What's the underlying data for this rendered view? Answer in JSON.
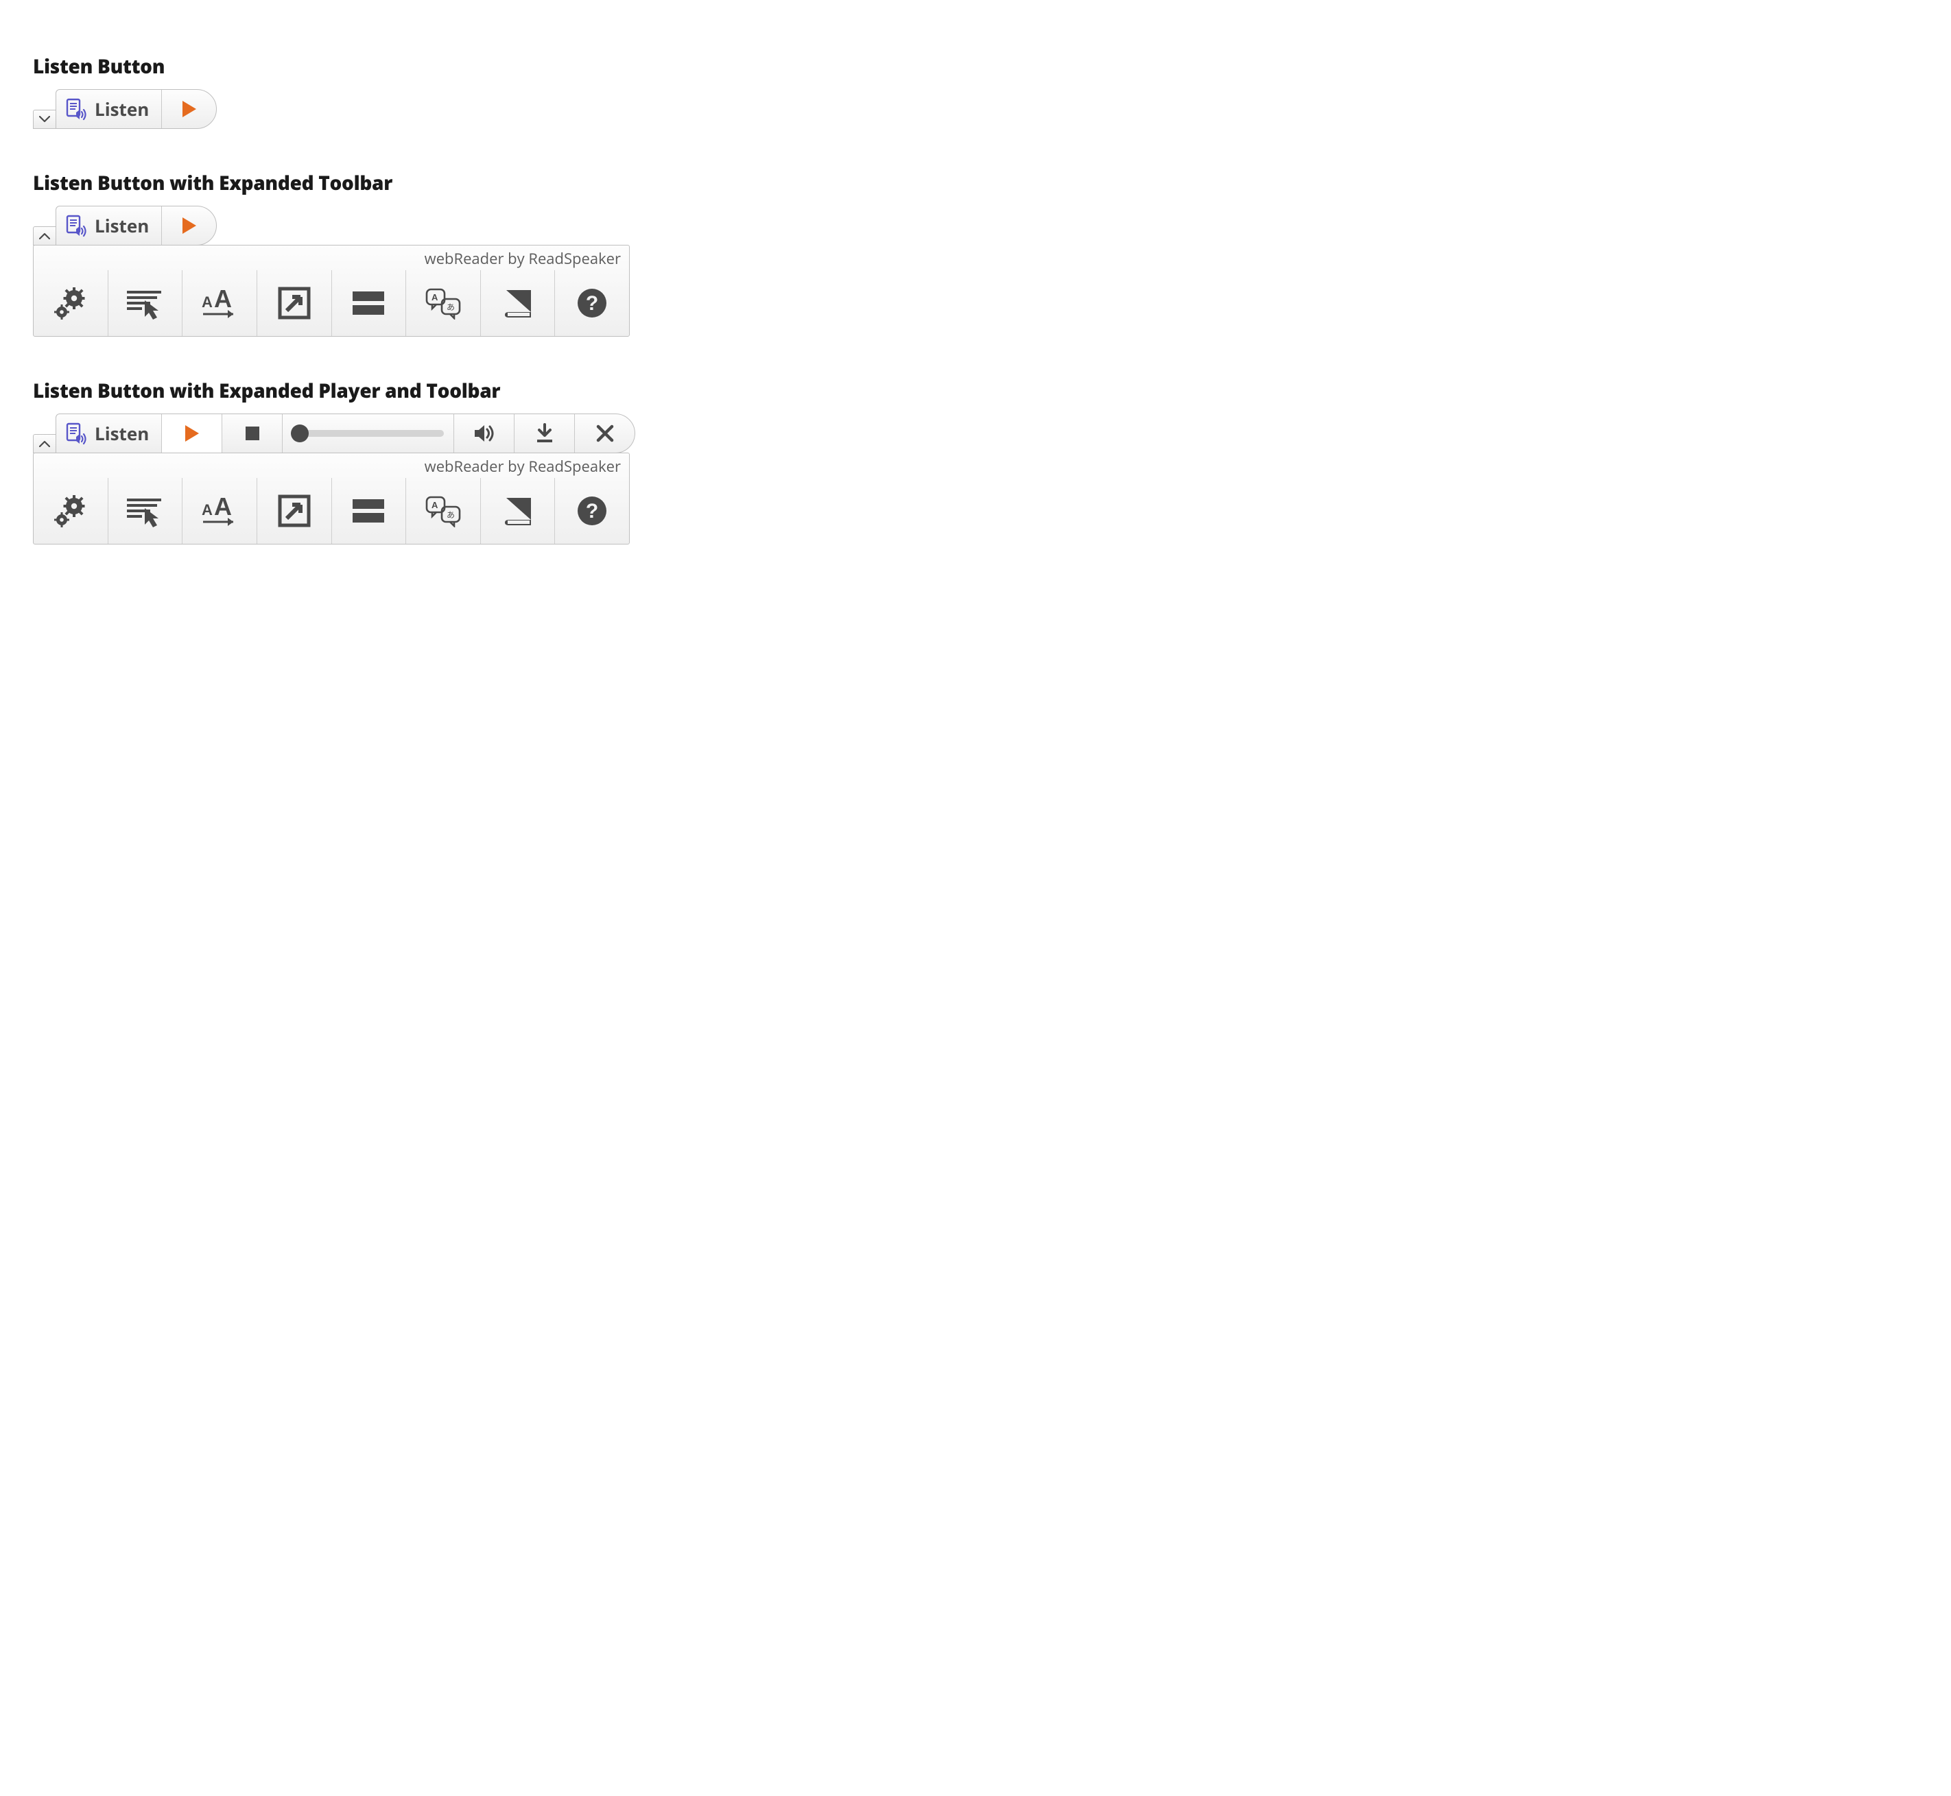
{
  "sections": {
    "simple": {
      "title": "Listen Button"
    },
    "toolbar": {
      "title": "Listen Button with Expanded Toolbar"
    },
    "player": {
      "title": "Listen Button with Expanded Player and Toolbar"
    }
  },
  "listen": {
    "label": "Listen"
  },
  "brand": {
    "text": "webReader by ReadSpeaker"
  },
  "colors": {
    "accent_orange": "#e56b1f",
    "icon_dark": "#4a4a4a",
    "logo_blue": "#5856c9"
  },
  "toolbar_items": [
    {
      "name": "settings"
    },
    {
      "name": "click-and-listen"
    },
    {
      "name": "enlarge-text"
    },
    {
      "name": "text-mode"
    },
    {
      "name": "page-mask"
    },
    {
      "name": "translate"
    },
    {
      "name": "dictionary"
    },
    {
      "name": "help"
    }
  ],
  "player_controls": [
    {
      "name": "play"
    },
    {
      "name": "stop"
    },
    {
      "name": "seek"
    },
    {
      "name": "volume"
    },
    {
      "name": "download"
    },
    {
      "name": "close"
    }
  ]
}
